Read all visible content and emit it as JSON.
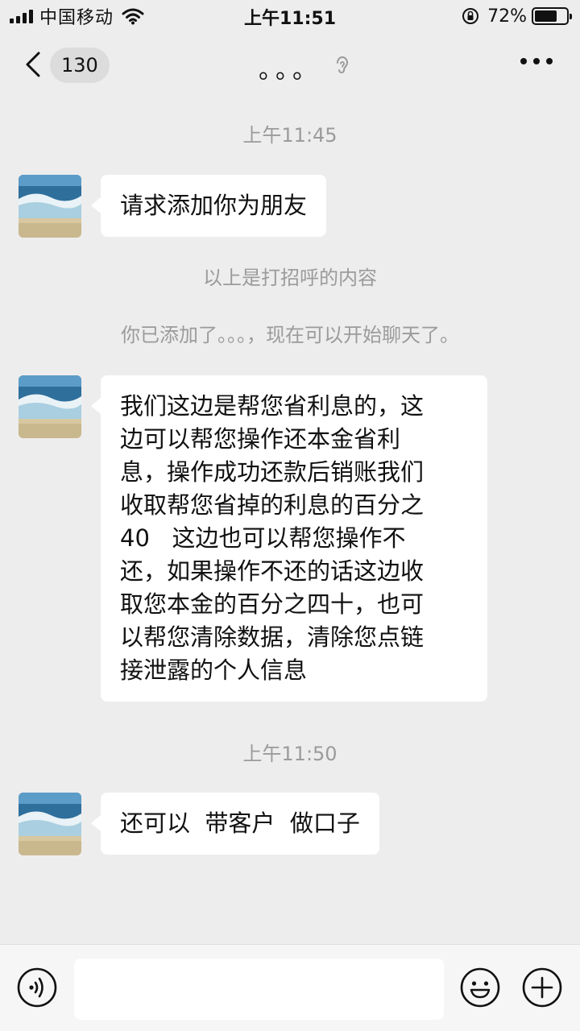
{
  "status_bar": {
    "carrier": "中国移动",
    "time": "上午11:51",
    "battery_percent": "72%",
    "battery_level": 0.72
  },
  "nav": {
    "unread_count": "130",
    "title": "。。。"
  },
  "messages": [
    {
      "type": "time",
      "text": "上午11:45"
    },
    {
      "type": "incoming",
      "text": "请求添加你为朋友"
    },
    {
      "type": "system",
      "text": "以上是打招呼的内容"
    },
    {
      "type": "system",
      "text": "你已添加了。。。，现在可以开始聊天了。"
    },
    {
      "type": "incoming",
      "lines": [
        "我们这边是帮您省利息的，这",
        "边可以帮您操作还本金省利",
        "息，操作成功还款后销账我们",
        "收取帮您省掉的利息的百分之",
        "40   这边也可以帮您操作不",
        "还，如果操作不还的话这边收",
        "取您本金的百分之四十，也可",
        "以帮您清除数据，清除您点链",
        "接泄露的个人信息"
      ]
    },
    {
      "type": "time",
      "text": "上午11:50"
    },
    {
      "type": "incoming",
      "text": "还可以  带客户  做口子"
    }
  ],
  "input_bar": {
    "placeholder": ""
  },
  "icons": {
    "back": "chevron-left-icon",
    "ear": "ear-icon",
    "more": "more-dots-icon",
    "voice": "voice-icon",
    "emoji": "emoji-icon",
    "plus": "plus-icon"
  }
}
